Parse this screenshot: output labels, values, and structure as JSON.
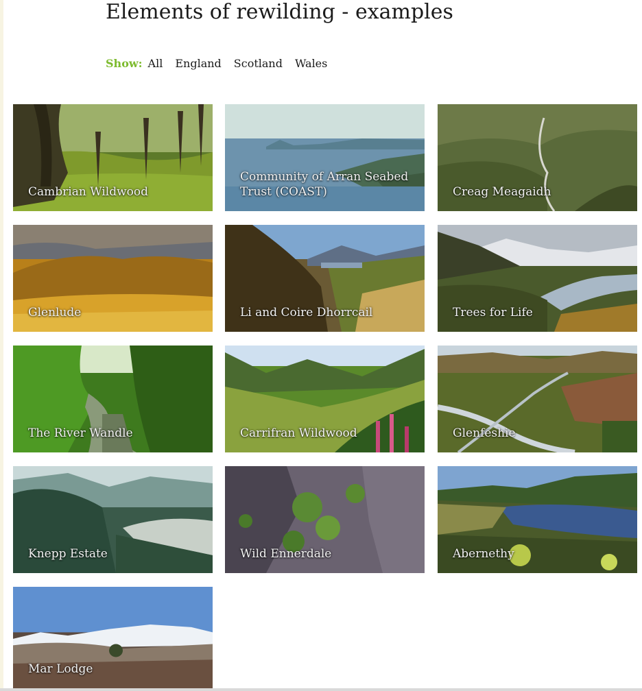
{
  "page": {
    "title": "Elements of rewilding - examples"
  },
  "filter": {
    "label": "Show:",
    "options": [
      "All",
      "England",
      "Scotland",
      "Wales"
    ]
  },
  "tiles": [
    {
      "label": "Cambrian Wildwood"
    },
    {
      "label": "Community of Arran Seabed Trust (COAST)"
    },
    {
      "label": "Creag Meagaidh"
    },
    {
      "label": "Glenlude"
    },
    {
      "label": "Li and Coire Dhorrcail"
    },
    {
      "label": "Trees for Life"
    },
    {
      "label": "The River Wandle"
    },
    {
      "label": "Carrifran Wildwood"
    },
    {
      "label": "Glenfeshie"
    },
    {
      "label": "Knepp Estate"
    },
    {
      "label": "Wild Ennerdale"
    },
    {
      "label": "Abernethy"
    },
    {
      "label": "Mar Lodge"
    }
  ],
  "colors": {
    "accent": "#7dbb2e",
    "text": "#1a1a1a"
  }
}
